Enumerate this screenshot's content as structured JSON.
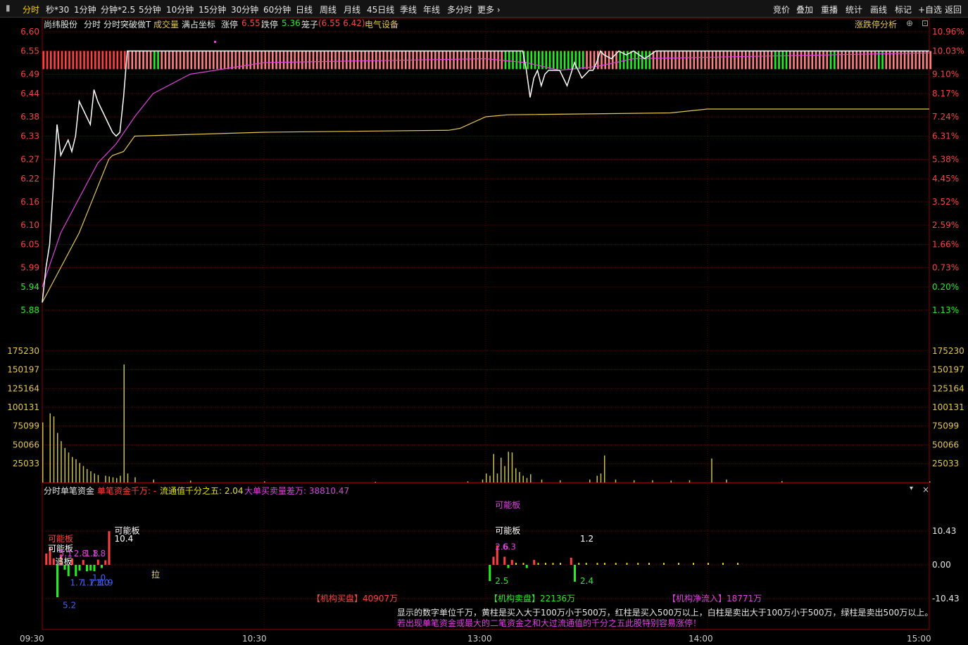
{
  "toolbar": {
    "tabs": [
      "分时",
      "秒*30",
      "1分钟",
      "分钟*2.5",
      "5分钟",
      "10分钟",
      "15分钟",
      "30分钟",
      "60分钟",
      "日线",
      "周线",
      "月线",
      "45日线",
      "季线",
      "年线",
      "多分时",
      "更多 ›"
    ],
    "right": [
      "竞价",
      "叠加",
      "重播",
      "统计",
      "画线",
      "标记",
      "+自选",
      "返回"
    ]
  },
  "info": {
    "stock_name": "尚纬股份",
    "mode": "分时",
    "indicator": "分时突破做T",
    "volume_label": "成交量",
    "coord_label": "满占坐标",
    "up_label": "涨停",
    "up_value": "6.55",
    "down_label": "跌停",
    "down_value": "5.36",
    "cage_label": "笼子",
    "cage_value": "(6.55 6.42)",
    "industry": "电气设备",
    "limit_analysis": "涨跌停分析"
  },
  "sub": {
    "title": "分时单笔资金",
    "p1": "单笔资金千万: -",
    "p2": "流通值千分之五: 2.04",
    "p3": "大单买卖量差万: 38810.47",
    "buy": "【机构买盘】40907万",
    "sell": "【机构卖盘】22136万",
    "net": "【机构净流入】18771万",
    "note1": "显示的数字单位千万，黄柱是买入大于100万小于500万，红柱是买入500万以上，白柱是卖出大于100万小于500万，绿柱是卖出500万以上。",
    "note2": "若出现单笔资金或最大的二笔资金之和大过流通值的千分之五此股特别容易涨停！"
  },
  "chart_data": {
    "type": "line",
    "price_axis": [
      "6.60",
      "6.55",
      "6.49",
      "6.44",
      "6.38",
      "6.33",
      "6.27",
      "6.22",
      "6.16",
      "6.10",
      "6.05",
      "5.99",
      "5.94",
      "5.88"
    ],
    "pct_axis": [
      "10.96%",
      "10.03%",
      "9.10%",
      "8.17%",
      "7.24%",
      "6.31%",
      "5.38%",
      "4.45%",
      "3.52%",
      "2.59%",
      "1.66%",
      "0.73%",
      "0.20%",
      "1.13%"
    ],
    "volume_axis": [
      "175230",
      "150197",
      "125164",
      "100131",
      "75099",
      "50066",
      "25033"
    ],
    "flow_axis": [
      "10.43",
      "0.00",
      "-10.43"
    ],
    "time_labels": [
      "09:30",
      "10:30",
      "13:00",
      "14:00",
      "15:00"
    ],
    "colors": {
      "price": "#ffffff",
      "avg": "#e6c84a",
      "ma": "#e040e0",
      "up": "#ff4040",
      "down": "#22ee22",
      "volume": "#c8c040",
      "limitbar": "#ff8080"
    },
    "price": [
      [
        0,
        5.9
      ],
      [
        1,
        5.99
      ],
      [
        2,
        6.05
      ],
      [
        3,
        6.2
      ],
      [
        4,
        6.36
      ],
      [
        5,
        6.28
      ],
      [
        6,
        6.3
      ],
      [
        7,
        6.32
      ],
      [
        8,
        6.29
      ],
      [
        9,
        6.33
      ],
      [
        10,
        6.42
      ],
      [
        11,
        6.4
      ],
      [
        12,
        6.38
      ],
      [
        13,
        6.36
      ],
      [
        14,
        6.45
      ],
      [
        15,
        6.42
      ],
      [
        16,
        6.4
      ],
      [
        17,
        6.38
      ],
      [
        18,
        6.36
      ],
      [
        19,
        6.34
      ],
      [
        20,
        6.33
      ],
      [
        21,
        6.34
      ],
      [
        22,
        6.43
      ],
      [
        23,
        6.55
      ],
      [
        30,
        6.55
      ],
      [
        60,
        6.55
      ],
      [
        120,
        6.55
      ],
      [
        130,
        6.55
      ],
      [
        131,
        6.5
      ],
      [
        132,
        6.43
      ],
      [
        133,
        6.48
      ],
      [
        134,
        6.5
      ],
      [
        135,
        6.46
      ],
      [
        136,
        6.49
      ],
      [
        137,
        6.5
      ],
      [
        140,
        6.5
      ],
      [
        141,
        6.48
      ],
      [
        142,
        6.46
      ],
      [
        143,
        6.49
      ],
      [
        144,
        6.52
      ],
      [
        145,
        6.5
      ],
      [
        146,
        6.48
      ],
      [
        147,
        6.49
      ],
      [
        148,
        6.5
      ],
      [
        149,
        6.5
      ],
      [
        150,
        6.52
      ],
      [
        151,
        6.55
      ],
      [
        152,
        6.54
      ],
      [
        154,
        6.53
      ],
      [
        156,
        6.55
      ],
      [
        158,
        6.54
      ],
      [
        160,
        6.55
      ],
      [
        163,
        6.53
      ],
      [
        166,
        6.55
      ],
      [
        170,
        6.55
      ],
      [
        200,
        6.55
      ],
      [
        240,
        6.55
      ]
    ],
    "avg_price": [
      [
        0,
        5.9
      ],
      [
        10,
        6.08
      ],
      [
        18,
        6.27
      ],
      [
        19,
        6.28
      ],
      [
        22,
        6.29
      ],
      [
        25,
        6.33
      ],
      [
        60,
        6.34
      ],
      [
        110,
        6.345
      ],
      [
        113,
        6.35
      ],
      [
        120,
        6.38
      ],
      [
        126,
        6.385
      ],
      [
        170,
        6.39
      ],
      [
        180,
        6.4
      ],
      [
        240,
        6.4
      ]
    ],
    "ma_line": [
      [
        0,
        5.94
      ],
      [
        5,
        6.08
      ],
      [
        15,
        6.26
      ],
      [
        20,
        6.31
      ],
      [
        25,
        6.38
      ],
      [
        30,
        6.44
      ],
      [
        40,
        6.49
      ],
      [
        60,
        6.52
      ],
      [
        120,
        6.53
      ],
      [
        131,
        6.52
      ],
      [
        140,
        6.5
      ],
      [
        150,
        6.51
      ],
      [
        160,
        6.53
      ],
      [
        240,
        6.545
      ]
    ],
    "volume": [
      [
        0,
        80000
      ],
      [
        2,
        92000
      ],
      [
        3,
        88000
      ],
      [
        4,
        66000
      ],
      [
        5,
        55000
      ],
      [
        6,
        46000
      ],
      [
        7,
        40000
      ],
      [
        8,
        34000
      ],
      [
        9,
        31000
      ],
      [
        10,
        26000
      ],
      [
        11,
        22000
      ],
      [
        12,
        18000
      ],
      [
        13,
        15000
      ],
      [
        14,
        12000
      ],
      [
        15,
        10000
      ],
      [
        17,
        9000
      ],
      [
        18,
        8000
      ],
      [
        19,
        7000
      ],
      [
        20,
        6000
      ],
      [
        21,
        9000
      ],
      [
        22,
        157000
      ],
      [
        23,
        12000
      ],
      [
        25,
        7000
      ],
      [
        30,
        4000
      ],
      [
        40,
        2500
      ],
      [
        60,
        1500
      ],
      [
        90,
        1000
      ],
      [
        115,
        1500
      ],
      [
        119,
        4000
      ],
      [
        120,
        12000
      ],
      [
        121,
        9000
      ],
      [
        122,
        38000
      ],
      [
        123,
        12000
      ],
      [
        124,
        33000
      ],
      [
        125,
        22000
      ],
      [
        126,
        41000
      ],
      [
        127,
        40000
      ],
      [
        128,
        19000
      ],
      [
        129,
        14000
      ],
      [
        130,
        9000
      ],
      [
        131,
        6000
      ],
      [
        132,
        11000
      ],
      [
        135,
        4000
      ],
      [
        140,
        3000
      ],
      [
        148,
        4000
      ],
      [
        150,
        9000
      ],
      [
        151,
        12000
      ],
      [
        152,
        36000
      ],
      [
        155,
        4000
      ],
      [
        160,
        3000
      ],
      [
        165,
        3000
      ],
      [
        170,
        2500
      ],
      [
        175,
        3000
      ],
      [
        181,
        32000
      ],
      [
        185,
        4000
      ],
      [
        200,
        2000
      ],
      [
        240,
        1500
      ]
    ],
    "flow_bars": [
      {
        "t": 1,
        "v": 3.5,
        "c": "red"
      },
      {
        "t": 2,
        "v": 5.5,
        "c": "red"
      },
      {
        "t": 3,
        "v": 2.0,
        "c": "red"
      },
      {
        "t": 4,
        "v": -10.0,
        "c": "green"
      },
      {
        "t": 5,
        "v": 3.2,
        "c": "red"
      },
      {
        "t": 6,
        "v": -1.5,
        "c": "green"
      },
      {
        "t": 7,
        "v": -3.5,
        "c": "green"
      },
      {
        "t": 8,
        "v": 2.0,
        "c": "red"
      },
      {
        "t": 9,
        "v": -3.5,
        "c": "green"
      },
      {
        "t": 10,
        "v": -1.8,
        "c": "green"
      },
      {
        "t": 11,
        "v": 1.5,
        "c": "red"
      },
      {
        "t": 12,
        "v": -2.0,
        "c": "green"
      },
      {
        "t": 13,
        "v": -1.8,
        "c": "green"
      },
      {
        "t": 14,
        "v": -2.0,
        "c": "green"
      },
      {
        "t": 15,
        "v": 1.6,
        "c": "red"
      },
      {
        "t": 16,
        "v": -1.0,
        "c": "green"
      },
      {
        "t": 17,
        "v": 1.4,
        "c": "red"
      },
      {
        "t": 18,
        "v": 10.4,
        "c": "red"
      },
      {
        "t": 121,
        "v": -5.0,
        "c": "green"
      },
      {
        "t": 122,
        "v": 2.5,
        "c": "red"
      },
      {
        "t": 123,
        "v": 6.0,
        "c": "red"
      },
      {
        "t": 125,
        "v": 2.5,
        "c": "red"
      },
      {
        "t": 126,
        "v": -1.0,
        "c": "green"
      },
      {
        "t": 127,
        "v": 1.5,
        "c": "red"
      },
      {
        "t": 131,
        "v": -1.0,
        "c": "green"
      },
      {
        "t": 133,
        "v": 1.5,
        "c": "red"
      },
      {
        "t": 143,
        "v": 2.2,
        "c": "red"
      },
      {
        "t": 144,
        "v": -5.2,
        "c": "green"
      }
    ],
    "flow_yellow_ticks": [
      128,
      130,
      134,
      136,
      138,
      140,
      145,
      147,
      150,
      152,
      155,
      158,
      161,
      164,
      168,
      172,
      176,
      180,
      184,
      188
    ],
    "annotations": [
      {
        "t": 0,
        "v": 8,
        "text": "可能板",
        "c": "#ff4040"
      },
      {
        "t": 0,
        "v": 5,
        "text": "可能板",
        "c": "#ffffff"
      },
      {
        "t": 2,
        "v": 1,
        "text": "追板",
        "c": "#ffffff"
      },
      {
        "t": 3,
        "v": 3.5,
        "text": "5.1",
        "c": "#e040e0"
      },
      {
        "t": 7,
        "v": 3.5,
        "text": "2.8",
        "c": "#e040e0"
      },
      {
        "t": 10,
        "v": 3.5,
        "text": "1.8",
        "c": "#e040e0"
      },
      {
        "t": 12,
        "v": 3.5,
        "text": "1.8",
        "c": "#e040e0"
      },
      {
        "t": 4,
        "v": -12.5,
        "text": "5.2",
        "c": "#4060ff"
      },
      {
        "t": 6,
        "v": -5.5,
        "text": "1.7",
        "c": "#4060ff"
      },
      {
        "t": 9,
        "v": -5.5,
        "text": "1.7",
        "c": "#4060ff"
      },
      {
        "t": 11,
        "v": -5.5,
        "text": "1.3",
        "c": "#4060ff"
      },
      {
        "t": 12,
        "v": -4.0,
        "text": "1.0",
        "c": "#4060ff"
      },
      {
        "t": 13,
        "v": -5.5,
        "text": "1.0",
        "c": "#4060ff"
      },
      {
        "t": 14,
        "v": -5.5,
        "text": "1.9",
        "c": "#4060ff"
      },
      {
        "t": 18,
        "v": 10.5,
        "text": "可能板",
        "c": "#ffffff"
      },
      {
        "t": 18,
        "v": 8,
        "text": "10.4",
        "c": "#ffffff"
      },
      {
        "t": 28,
        "v": -3.0,
        "text": "拉",
        "c": "#e6e600"
      },
      {
        "t": 121,
        "v": 18.5,
        "text": "可能板",
        "c": "#e040e0"
      },
      {
        "t": 121,
        "v": 10.5,
        "text": "可能板",
        "c": "#ffffff"
      },
      {
        "t": 121,
        "v": 5.5,
        "text": "2.6",
        "c": "#e040e0"
      },
      {
        "t": 123,
        "v": 5.5,
        "text": "6.3",
        "c": "#e040e0"
      },
      {
        "t": 121,
        "v": -5.0,
        "text": "2.5",
        "c": "#22ee22"
      },
      {
        "t": 144,
        "v": 8.0,
        "text": "1.2",
        "c": "#ffffff"
      },
      {
        "t": 144,
        "v": -5.0,
        "text": "2.4",
        "c": "#22ee22"
      }
    ]
  }
}
